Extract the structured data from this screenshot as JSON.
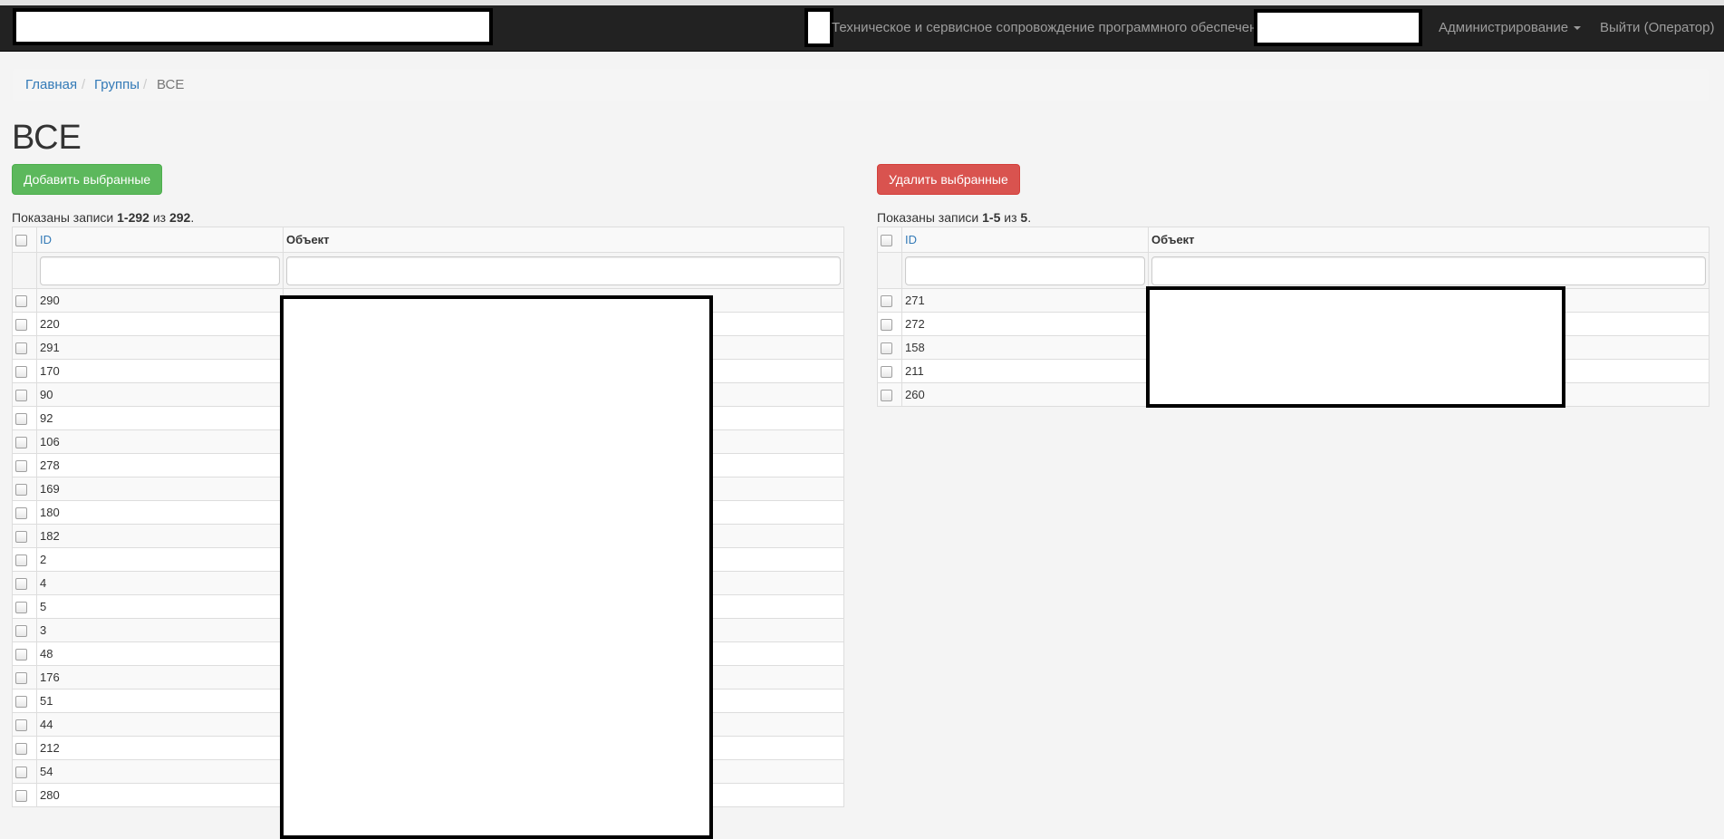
{
  "navbar": {
    "subtitle": "Техническое и сервисное сопровождение программного обеспечения",
    "admin_menu": "Администрирование",
    "logout": "Выйти (Оператор)"
  },
  "breadcrumb": {
    "home": "Главная",
    "groups": "Группы",
    "current": "ВСЕ",
    "separator": "/"
  },
  "page": {
    "title": "ВСЕ"
  },
  "left_panel": {
    "button_label": "Добавить выбранные",
    "summary": {
      "prefix": "Показаны записи ",
      "range": "1-292",
      "mid": " из ",
      "total": "292",
      "suffix": "."
    },
    "columns": {
      "id": "ID",
      "object": "Объект"
    },
    "filters": {
      "id_placeholder": "",
      "object_placeholder": ""
    },
    "rows": [
      "290",
      "220",
      "291",
      "170",
      "90",
      "92",
      "106",
      "278",
      "169",
      "180",
      "182",
      "2",
      "4",
      "5",
      "3",
      "48",
      "176",
      "51",
      "44",
      "212",
      "54",
      "280"
    ]
  },
  "right_panel": {
    "button_label": "Удалить выбранные",
    "summary": {
      "prefix": "Показаны записи ",
      "range": "1-5",
      "mid": " из ",
      "total": "5",
      "suffix": "."
    },
    "columns": {
      "id": "ID",
      "object": "Объект"
    },
    "filters": {
      "id_placeholder": "",
      "object_placeholder": ""
    },
    "rows": [
      "271",
      "272",
      "158",
      "211",
      "260"
    ]
  },
  "colors": {
    "navbar": "#222222",
    "link": "#337ab7",
    "success": "#5cb85c",
    "danger": "#d9534f"
  }
}
